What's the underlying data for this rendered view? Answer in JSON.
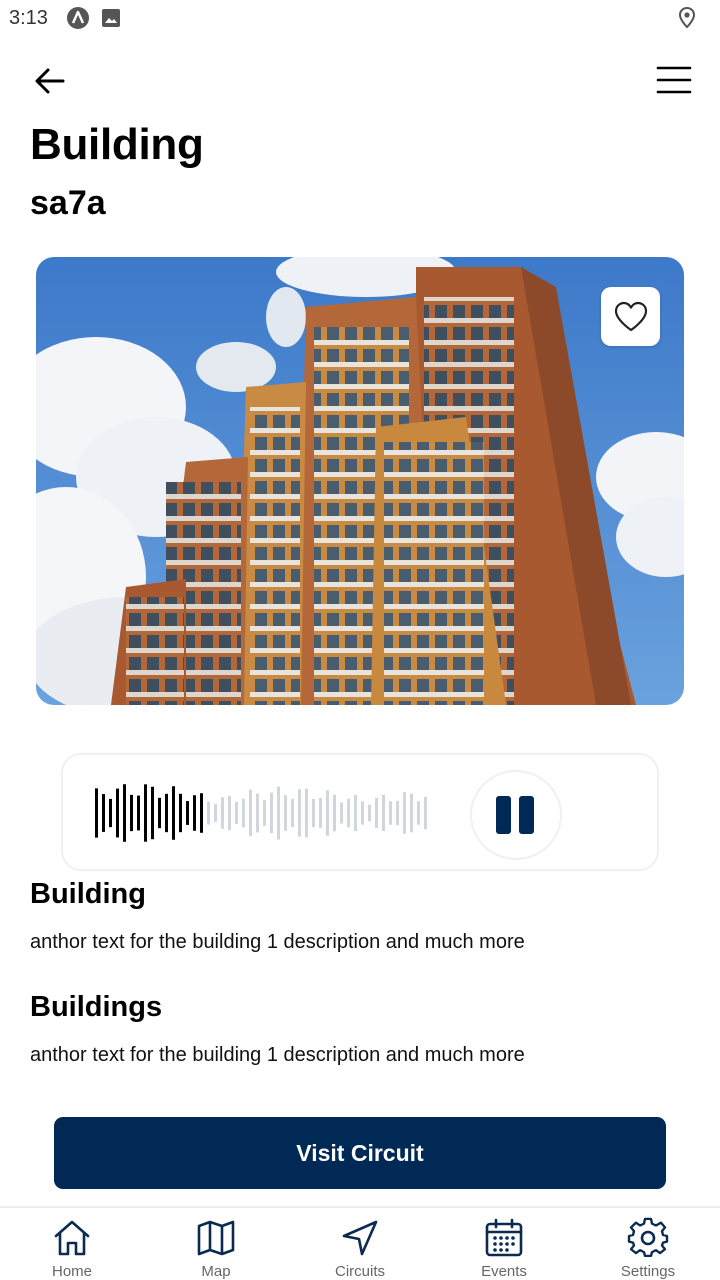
{
  "status_bar": {
    "time": "3:13",
    "icons": [
      "app-a-icon",
      "image-icon",
      "location-pin-icon"
    ]
  },
  "header": {
    "back_icon": "arrow-left-icon",
    "menu_icon": "hamburger-menu-icon",
    "title": "Building",
    "subtitle": "sa7a"
  },
  "hero": {
    "image": "building-photo",
    "favorite_icon": "heart-outline-icon"
  },
  "audio_player": {
    "state": "playing",
    "control_icon": "pause-icon",
    "progress": 0.32,
    "accent_color": "#002a55"
  },
  "sections": [
    {
      "title": "Building",
      "text": "anthor text for the building 1 description and much more"
    },
    {
      "title": "Buildings",
      "text": "anthor text for the building 1 description and much more"
    }
  ],
  "actions": {
    "visit_label": "Visit Circuit"
  },
  "bottom_nav": [
    {
      "label": "Home",
      "icon": "home-icon"
    },
    {
      "label": "Map",
      "icon": "map-icon"
    },
    {
      "label": "Circuits",
      "icon": "navigation-arrow-icon"
    },
    {
      "label": "Events",
      "icon": "calendar-icon"
    },
    {
      "label": "Settings",
      "icon": "gear-icon"
    }
  ],
  "colors": {
    "primary": "#002a55",
    "icon": "#0b2a4f",
    "nav_label": "#666666"
  }
}
